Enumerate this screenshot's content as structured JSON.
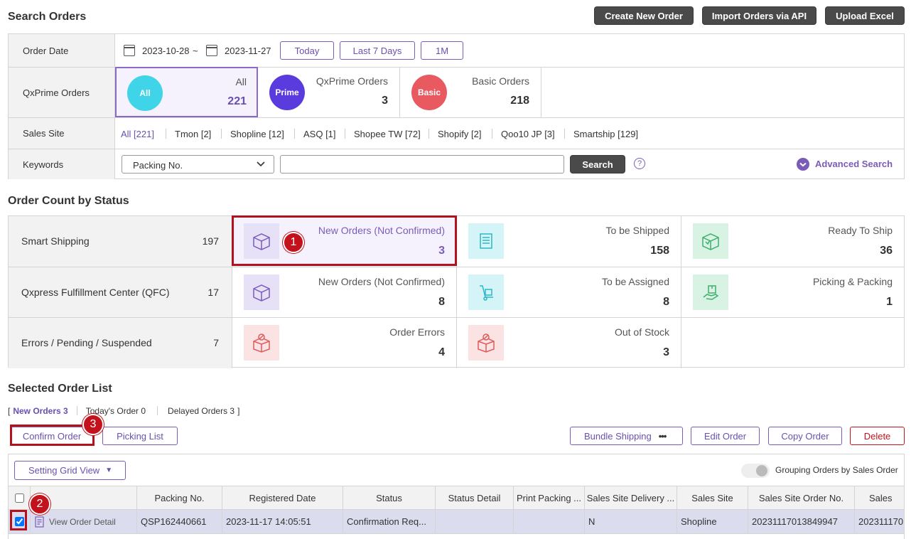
{
  "search": {
    "title": "Search Orders",
    "buttons": {
      "create": "Create New Order",
      "import": "Import Orders via API",
      "upload": "Upload Excel"
    },
    "order_date": {
      "label": "Order Date",
      "from": "2023-10-28",
      "tilde": "~",
      "to": "2023-11-27",
      "today": "Today",
      "last7": "Last 7 Days",
      "one_month": "1M"
    },
    "qxprime": {
      "label": "QxPrime Orders",
      "options": [
        {
          "badge": "All",
          "label": "All",
          "count": "221",
          "color": "#3fd4e8"
        },
        {
          "badge": "Prime",
          "label": "QxPrime Orders",
          "count": "3",
          "color": "#5a3bde"
        },
        {
          "badge": "Basic",
          "label": "Basic Orders",
          "count": "218",
          "color": "#e85a5f"
        }
      ]
    },
    "sales_site": {
      "label": "Sales Site",
      "items": [
        "All [221]",
        "Tmon [2]",
        "Shopline [12]",
        "ASQ [1]",
        "Shopee TW [72]",
        "Shopify [2]",
        "Qoo10 JP [3]",
        "Smartship [129]"
      ]
    },
    "keywords": {
      "label": "Keywords",
      "select_value": "Packing No.",
      "input_value": "",
      "search": "Search",
      "help": "?",
      "advanced": "Advanced Search"
    }
  },
  "status": {
    "title": "Order Count by Status",
    "rows": [
      {
        "label": "Smart Shipping",
        "count": "197",
        "cells": [
          {
            "label": "New Orders (Not Confirmed)",
            "count": "3",
            "icon": "box-icon"
          },
          {
            "label": "To be Shipped",
            "count": "158",
            "icon": "document-icon"
          },
          {
            "label": "Ready To Ship",
            "count": "36",
            "icon": "checked-box-icon"
          }
        ]
      },
      {
        "label": "Qxpress Fulfillment Center (QFC)",
        "count": "17",
        "cells": [
          {
            "label": "New Orders (Not Confirmed)",
            "count": "8",
            "icon": "box-icon"
          },
          {
            "label": "To be Assigned",
            "count": "8",
            "icon": "hand-truck-icon"
          },
          {
            "label": "Picking & Packing",
            "count": "1",
            "icon": "packing-icon"
          }
        ]
      },
      {
        "label": "Errors / Pending / Suspended",
        "count": "7",
        "cells": [
          {
            "label": "Order Errors",
            "count": "4",
            "icon": "error-box-icon"
          },
          {
            "label": "Out of Stock",
            "count": "3",
            "icon": "error-box-icon"
          }
        ]
      }
    ]
  },
  "list": {
    "title": "Selected Order List",
    "filter": {
      "open": "[",
      "new_orders": "New Orders 3",
      "today": "Today's Order 0",
      "delayed": "Delayed Orders 3",
      "close": "]"
    },
    "buttons": {
      "confirm": "Confirm Order",
      "picking": "Picking List",
      "bundle": "Bundle Shipping",
      "more": "•••",
      "edit": "Edit Order",
      "copy": "Copy Order",
      "delete": "Delete"
    },
    "grid_view": "Setting Grid View",
    "grouping": "Grouping Orders by Sales Order",
    "columns": [
      "Packing No.",
      "Registered Date",
      "Status",
      "Status Detail",
      "Print Packing ...",
      "Sales Site Delivery ...",
      "Sales Site",
      "Sales Site Order No.",
      "Sales"
    ],
    "row": {
      "detail": "View Order Detail",
      "cells": [
        "QSP162440661",
        "2023-11-17 14:05:51",
        "Confirmation Req...",
        "",
        "",
        "N",
        "Shopline",
        "20231117013849947",
        "202311170"
      ]
    }
  },
  "annotations": [
    "1",
    "2",
    "3"
  ]
}
